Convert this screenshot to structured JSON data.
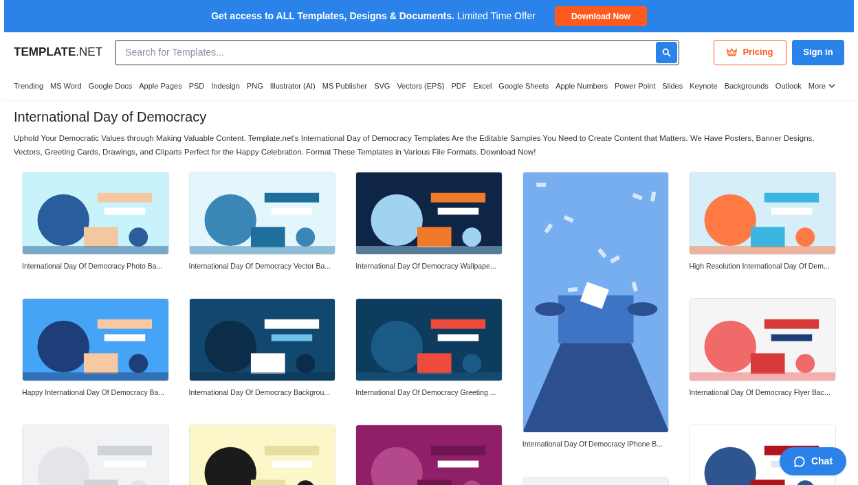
{
  "promo_banner": {
    "text": "**Get access to ALL Templates, Designs & Documents.** Limited Time Offer",
    "button": "Download Now"
  },
  "header": {
    "logo_bold": "TEMPLATE",
    "logo_rest": ".NET",
    "search": {
      "placeholder": "Search for Templates..."
    },
    "pricing": "Pricing",
    "sign_in": "Sign in"
  },
  "nav": {
    "items": [
      "Trending",
      "MS Word",
      "Google Docs",
      "Apple Pages",
      "PSD",
      "Indesign",
      "PNG",
      "Illustrator (AI)",
      "MS Publisher",
      "SVG",
      "Vectors (EPS)",
      "PDF",
      "Excel",
      "Google Sheets",
      "Apple Numbers",
      "Power Point",
      "Slides",
      "Keynote",
      "Backgrounds",
      "Outlook"
    ],
    "more": "More"
  },
  "page": {
    "title": "International Day of Democracy",
    "description": "Uphold Your Democratic Values through Making Valuable Content. Template.net's International Day of Democracy Templates Are the Editable Samples You Need to Create Content that Matters. We Have Posters, Banner Designs, Vectors, Greeting Cards, Drawings, and Cliparts Perfect for the Happy Celebration. Format These Templates in Various File Formats. Download Now!"
  },
  "columns": [
    [
      {
        "kind": "landscape",
        "caption": "International Day Of Democracy Photo Ba..."
      },
      {
        "kind": "landscape",
        "caption": "Happy International Day Of Democracy Ba..."
      },
      {
        "kind": "landscape"
      }
    ],
    [
      {
        "kind": "landscape",
        "caption": "International Day Of Democracy Vector Ba..."
      },
      {
        "kind": "landscape",
        "caption": "International Day Of Democracy Backgrou..."
      },
      {
        "kind": "landscape"
      }
    ],
    [
      {
        "kind": "landscape",
        "caption": "International Day Of Democracy Wallpape..."
      },
      {
        "kind": "landscape",
        "caption": "International Day Of Democracy Greeting ..."
      },
      {
        "kind": "landscape"
      }
    ],
    [
      {
        "kind": "portrait",
        "caption": "International Day Of Democracy IPhone B..."
      },
      {
        "kind": "landscape"
      }
    ],
    [
      {
        "kind": "landscape",
        "caption": "High Resolution International Day Of Dem..."
      },
      {
        "kind": "landscape",
        "caption": "International Day Of Democracy Flyer Bac..."
      },
      {
        "kind": "landscape"
      }
    ]
  ],
  "chat_button": "Chat"
}
